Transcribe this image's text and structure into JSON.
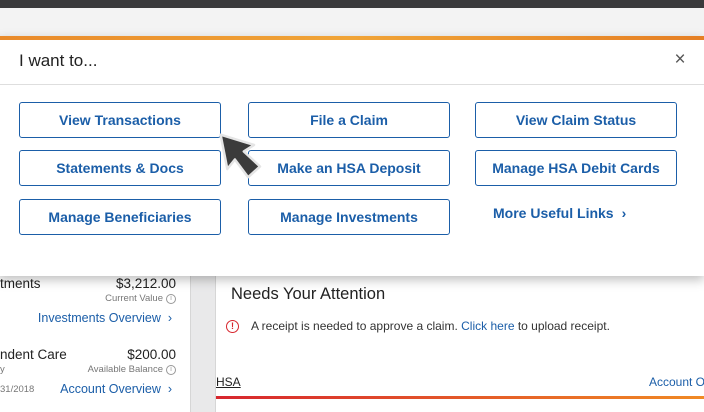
{
  "modal": {
    "title": "I want to...",
    "close_glyph": "×",
    "buttons": [
      {
        "label": "View Transactions"
      },
      {
        "label": "File a Claim"
      },
      {
        "label": "View Claim Status"
      },
      {
        "label": "Statements & Docs"
      },
      {
        "label": "Make an HSA Deposit"
      },
      {
        "label": "Manage HSA Debit Cards"
      },
      {
        "label": "Manage Beneficiaries"
      },
      {
        "label": "Manage Investments"
      }
    ],
    "more_link": {
      "label": "More Useful Links",
      "chevron": "›"
    }
  },
  "accounts": [
    {
      "name": "tments",
      "amount": "$3,212.00",
      "sub": "Current Value",
      "link": "Investments Overview",
      "chevron": "›"
    },
    {
      "name": "ndent Care",
      "amount": "$200.00",
      "sub_left": "y",
      "sub": "Available Balance",
      "date": "31/2018",
      "link": "Account Overview",
      "chevron": "›"
    }
  ],
  "attention": {
    "title": "Needs Your Attention",
    "alert_icon": "!",
    "alert_text": "A receipt is needed to approve a claim.",
    "alert_link": "Click here",
    "alert_suffix": "to upload receipt."
  },
  "section": {
    "hsa_label": "HSA",
    "account_link": "Account O"
  },
  "colors": {
    "accent": "#f0a437",
    "link": "#1b5ea8",
    "alert": "#d7262e"
  },
  "icons": {
    "close": "close-icon",
    "info": "info-icon",
    "pointer": "mouse-pointer-icon"
  }
}
